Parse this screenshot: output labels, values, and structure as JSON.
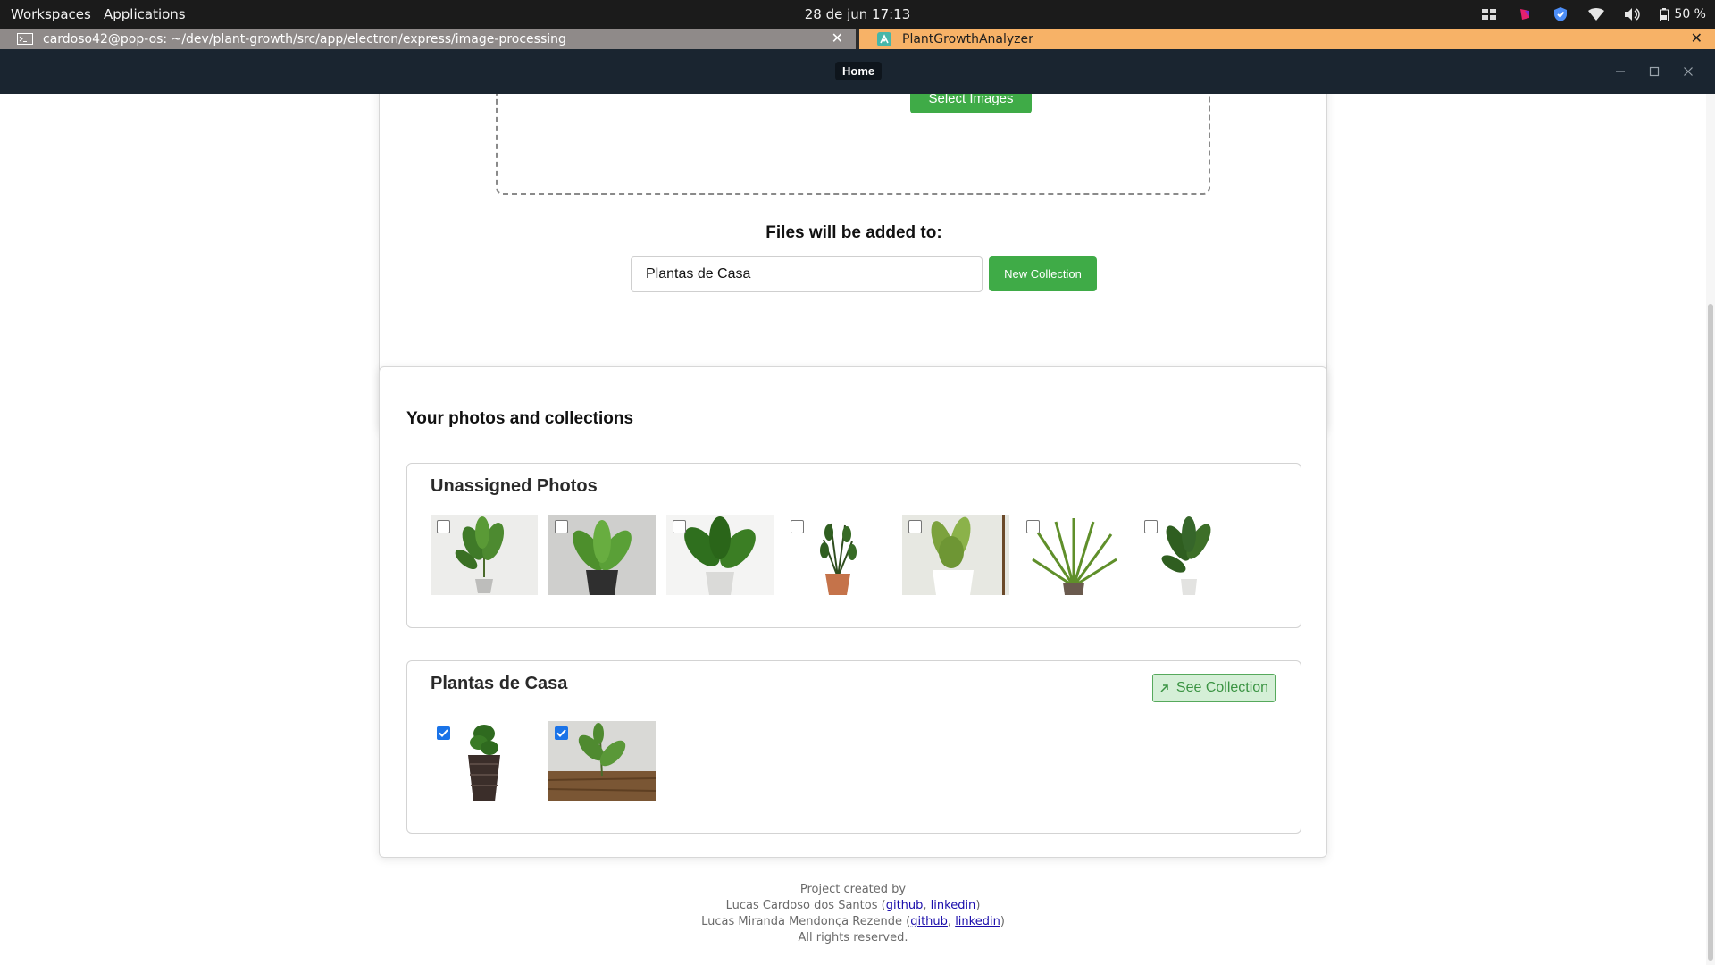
{
  "os": {
    "workspaces": "Workspaces",
    "applications": "Applications",
    "clock": "28 de jun  17:13",
    "battery": "50 %"
  },
  "tabs": [
    {
      "title": "cardoso42@pop-os: ~/dev/plant-growth/src/app/electron/express/image-processing",
      "icon": "terminal-icon"
    },
    {
      "title": "PlantGrowthAnalyzer",
      "icon": "app-icon"
    }
  ],
  "titlebar": {
    "home": "Home"
  },
  "upload": {
    "select_images": "Select Images",
    "files_heading": "Files will be added to:",
    "collection_value": "Plantas de Casa",
    "new_collection": "New Collection"
  },
  "photos": {
    "section_title": "Your photos and collections",
    "unassigned_title": "Unassigned Photos",
    "unassigned_count": 7,
    "unassigned_checked": [
      false,
      false,
      false,
      false,
      false,
      false,
      false
    ],
    "collection_title": "Plantas de Casa",
    "see_collection": "See Collection",
    "collection_checked": [
      true,
      true
    ]
  },
  "footer": {
    "line1": "Project created by",
    "author1": "Lucas Cardoso dos Santos",
    "author2": "Lucas Miranda Mendonça Rezende",
    "github": "github",
    "linkedin": "linkedin",
    "rights": "All rights reserved."
  },
  "colors": {
    "primary_green": "#3fab47",
    "titlebar": "#1a2530",
    "active_tab": "#f7b267",
    "checkbox_blue": "#1a73e8"
  }
}
